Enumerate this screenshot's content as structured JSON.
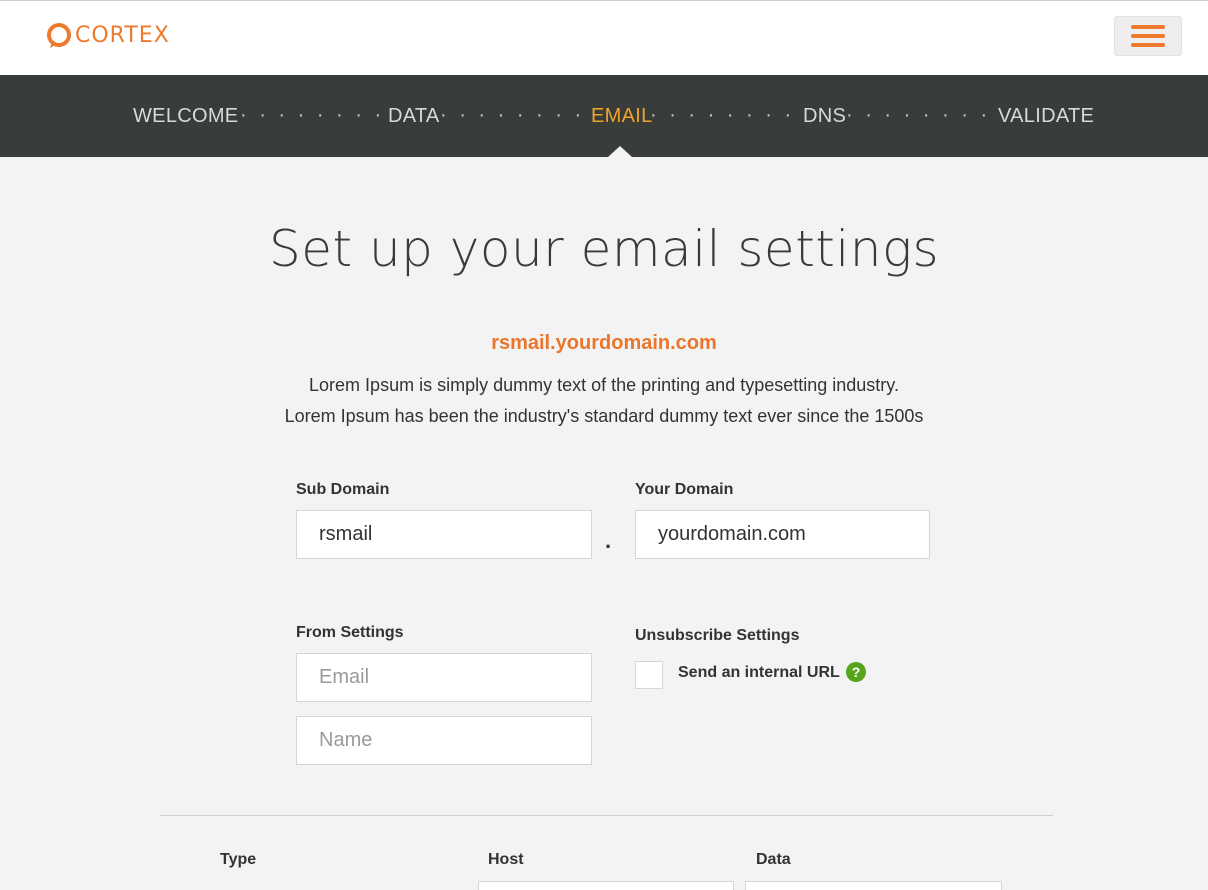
{
  "header": {
    "logo_text": "CORTEX",
    "brand_color": "#ee7a2e",
    "menu_icon": "hamburger-menu-icon"
  },
  "steps": [
    {
      "label": "WELCOME",
      "active": false
    },
    {
      "label": "DATA",
      "active": false
    },
    {
      "label": "EMAIL",
      "active": true
    },
    {
      "label": "DNS",
      "active": false
    },
    {
      "label": "VALIDATE",
      "active": false
    }
  ],
  "colors": {
    "stepbar_bg": "#393d3a",
    "step_active": "#f0a22c",
    "help_icon": "#55a51a"
  },
  "main": {
    "title": "Set up your email settings",
    "domain_preview": "rsmail.yourdomain.com",
    "description_line1": "Lorem Ipsum is simply dummy text of the printing and typesetting industry.",
    "description_line2": "Lorem Ipsum has been the industry's standard dummy text ever since the 1500s"
  },
  "form": {
    "sub_domain": {
      "label": "Sub Domain",
      "value": "rsmail"
    },
    "separator": ".",
    "your_domain": {
      "label": "Your Domain",
      "value": "yourdomain.com"
    },
    "from_settings": {
      "label": "From Settings",
      "email_placeholder": "Email",
      "name_placeholder": "Name"
    },
    "unsubscribe": {
      "label": "Unsubscribe Settings",
      "checkbox_label": "Send an internal URL",
      "checked": false,
      "help_glyph": "?"
    }
  },
  "records_table": {
    "columns": [
      "Type",
      "Host",
      "Data"
    ]
  }
}
